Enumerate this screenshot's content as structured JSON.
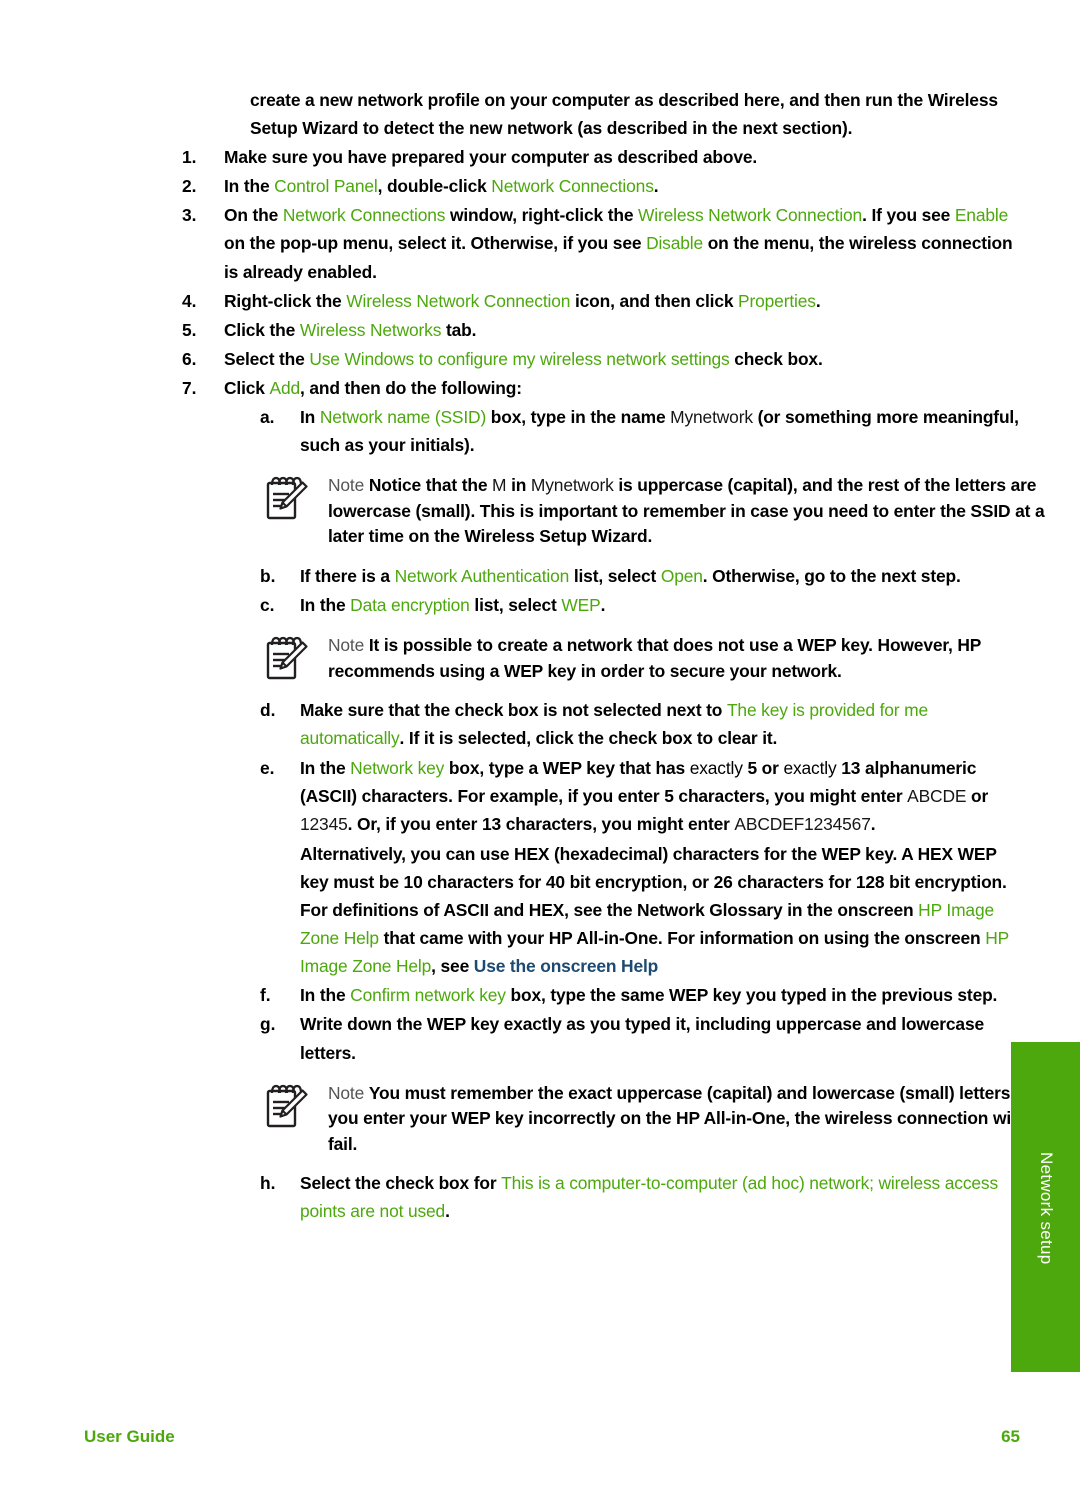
{
  "page": {
    "footer_left": "User Guide",
    "footer_page_number": "65",
    "side_tab_label": "Network setup",
    "accent_green": "#4ca80c",
    "xref_blue": "#1c4a72"
  },
  "lead_paragraph": [
    {
      "t": "create a new network profile on your ",
      "s": "b"
    },
    {
      "t": "computer as described here, and then run the Wireless Setup Wizard to detect the new network (as described in the next section).",
      "s": "b"
    }
  ],
  "steps": [
    {
      "marker": "1.",
      "runs": [
        {
          "t": "Make sure you have prepared ",
          "s": "b"
        },
        {
          "t": "your computer as described above.",
          "s": "b"
        }
      ]
    },
    {
      "marker": "2.",
      "runs": [
        {
          "t": "In the ",
          "s": "b"
        },
        {
          "t": "Control Panel",
          "s": "ui"
        },
        {
          "t": ", double-click ",
          "s": "b"
        },
        {
          "t": "Network Connections",
          "s": "ui"
        },
        {
          "t": ".",
          "s": "b"
        }
      ]
    },
    {
      "marker": "3.",
      "runs": [
        {
          "t": "On the ",
          "s": "b"
        },
        {
          "t": "Network Connections",
          "s": "ui"
        },
        {
          "t": " window, right-click the ",
          "s": "b"
        },
        {
          "t": "Wireless Network Connection",
          "s": "ui"
        },
        {
          "t": ". If you see ",
          "s": "b"
        },
        {
          "t": "Enable",
          "s": "ui"
        },
        {
          "t": " on the pop-up menu, select it. Otherwise, if you see ",
          "s": "b"
        },
        {
          "t": "Disable",
          "s": "ui"
        },
        {
          "t": " on the menu, the wireless connection is already enabled.",
          "s": "b"
        }
      ]
    },
    {
      "marker": "4.",
      "runs": [
        {
          "t": "Right-click the ",
          "s": "b"
        },
        {
          "t": "Wireless Network Connection",
          "s": "ui"
        },
        {
          "t": " icon, and then click ",
          "s": "b"
        },
        {
          "t": "Properties",
          "s": "ui"
        },
        {
          "t": ".",
          "s": "b"
        }
      ]
    },
    {
      "marker": "5.",
      "runs": [
        {
          "t": "Click the ",
          "s": "b"
        },
        {
          "t": "Wireless Networks",
          "s": "ui"
        },
        {
          "t": " tab.",
          "s": "b"
        }
      ]
    },
    {
      "marker": "6.",
      "runs": [
        {
          "t": "Select the ",
          "s": "b"
        },
        {
          "t": "Use Windows to configure my wireless network settings",
          "s": "ui"
        },
        {
          "t": " check box.",
          "s": "b"
        }
      ]
    },
    {
      "marker": "7.",
      "runs": [
        {
          "t": "Click ",
          "s": "b"
        },
        {
          "t": "Add",
          "s": "ui"
        },
        {
          "t": ", and then do the following:",
          "s": "b"
        }
      ]
    }
  ],
  "substeps": [
    {
      "marker": "a.",
      "runs": [
        {
          "t": "In ",
          "s": "b"
        },
        {
          "t": "Network name (SSID)",
          "s": "ui"
        },
        {
          "t": " box, type in the name ",
          "s": "b"
        },
        {
          "t": "Mynetwork",
          "s": "lit"
        },
        {
          "t": " (or something more meaningful, such as your initials).",
          "s": "b"
        }
      ]
    },
    {
      "marker": "b.",
      "runs": [
        {
          "t": "If there is a ",
          "s": "b"
        },
        {
          "t": "Network Authentication",
          "s": "ui"
        },
        {
          "t": " list, select ",
          "s": "b"
        },
        {
          "t": "Open",
          "s": "ui"
        },
        {
          "t": ". Otherwise, go to the next step.",
          "s": "b"
        }
      ]
    },
    {
      "marker": "c.",
      "runs": [
        {
          "t": "In the ",
          "s": "b"
        },
        {
          "t": "Data encryption",
          "s": "ui"
        },
        {
          "t": " list, select ",
          "s": "b"
        },
        {
          "t": "WEP",
          "s": "ui"
        },
        {
          "t": ".",
          "s": "b"
        }
      ]
    },
    {
      "marker": "d.",
      "runs": [
        {
          "t": "Make sure that the check box is ",
          "s": "b"
        },
        {
          "t": "not",
          "s": "b"
        },
        {
          "t": " selected next to ",
          "s": "b"
        },
        {
          "t": "The key is provided for me automatically",
          "s": "ui"
        },
        {
          "t": ". If it is selected, click the check box to clear it.",
          "s": "b"
        }
      ]
    },
    {
      "marker": "e.",
      "runs": [
        {
          "t": "In the ",
          "s": "b"
        },
        {
          "t": "Network key",
          "s": "ui"
        },
        {
          "t": " box, type a WEP key that has ",
          "s": "b"
        },
        {
          "t": "exactly ",
          "s": "p"
        },
        {
          "t": "5",
          "s": "b"
        },
        {
          "t": " or ",
          "s": "b"
        },
        {
          "t": "exactly ",
          "s": "p"
        },
        {
          "t": "13",
          "s": "b"
        },
        {
          "t": " alphanumeric (ASCII) characters. For example, if you enter 5 characters, you might enter ",
          "s": "b"
        },
        {
          "t": "ABCDE",
          "s": "lit"
        },
        {
          "t": " or ",
          "s": "b"
        },
        {
          "t": "12345",
          "s": "lit"
        },
        {
          "t": ". Or, if you enter 13 characters, you might enter ",
          "s": "b"
        },
        {
          "t": "ABCDEF1234567",
          "s": "lit"
        },
        {
          "t": ".",
          "s": "b"
        }
      ]
    },
    {
      "marker": "f.",
      "runs": [
        {
          "t": "In the ",
          "s": "b"
        },
        {
          "t": "Confirm network key",
          "s": "ui"
        },
        {
          "t": " box, type the same WEP key you typed in the previous step.",
          "s": "b"
        }
      ]
    },
    {
      "marker": "g.",
      "runs": [
        {
          "t": "Write down the WEP key exactly as you typed it, including uppercase and lowercase letters.",
          "s": "b"
        }
      ]
    },
    {
      "marker": "h.",
      "runs": [
        {
          "t": "Select the check box for ",
          "s": "b"
        },
        {
          "t": "This is a computer-to-computer (ad hoc) network; wireless access points are not used",
          "s": "ui"
        },
        {
          "t": ".",
          "s": "b"
        }
      ]
    }
  ],
  "substep_e_continuation": [
    {
      "t": "Alternatively, you can use HEX (hexadecimal) characters for the WEP key. A HEX WEP key must be 10 characters for 40 bit encryption, or 26 characters for 128 bit encryption. For definitions of ASCII and HEX, see the Network Glossary in the onscreen ",
      "s": "b"
    },
    {
      "t": "HP Image Zone Help",
      "s": "ui"
    },
    {
      "t": " that came with your HP All-in-One. For information on using the onscreen ",
      "s": "b"
    },
    {
      "t": "HP Image Zone Help",
      "s": "ui"
    },
    {
      "t": ", see ",
      "s": "b"
    },
    {
      "t": "Use the onscreen Help",
      "s": "xref"
    }
  ],
  "notes": [
    {
      "icon": "note-pad-pencil-icon",
      "label": "Note",
      "runs": [
        {
          "t": "Notice that the ",
          "s": "b"
        },
        {
          "t": "M",
          "s": "lit"
        },
        {
          "t": " in ",
          "s": "b"
        },
        {
          "t": "Mynetwork",
          "s": "lit"
        },
        {
          "t": " is uppercase (capital), and the rest of the letters are lowercase (small). This is important to remember in case you need to enter ",
          "s": "b"
        },
        {
          "t": "the SSID at a later time on the Wireless Setup Wizard.",
          "s": "b"
        }
      ]
    },
    {
      "icon": "note-pad-pencil-icon",
      "label": "Note",
      "runs": [
        {
          "t": "It is possible to create a network that does not use a WEP key. However, HP recommends using a WEP key in order to secure your network.",
          "s": "b"
        }
      ]
    },
    {
      "icon": "note-pad-pencil-icon",
      "label": "Note",
      "runs": [
        {
          "t": "You must remember the exact uppercase (capital) and lowercase (small) letters. If you enter your WEP key incorrectly on the HP All-in-One, the wireless connection will fail.",
          "s": "b"
        }
      ]
    }
  ]
}
